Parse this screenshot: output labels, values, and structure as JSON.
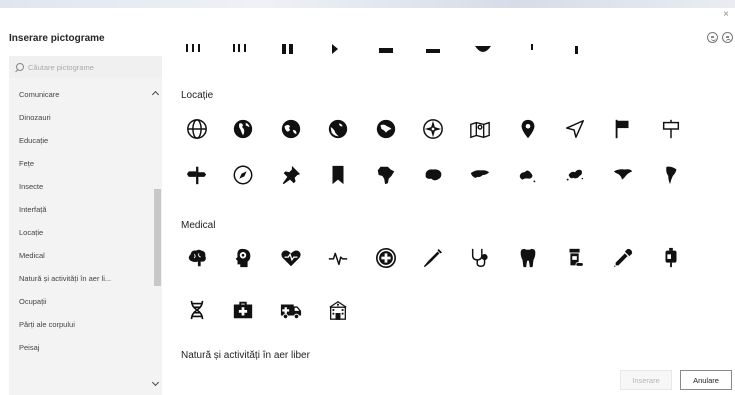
{
  "dialog": {
    "title": "Inserare pictograme",
    "close_label": "×"
  },
  "search": {
    "placeholder": "Căutare pictograme"
  },
  "sidebar": {
    "items": [
      {
        "label": "Comunicare"
      },
      {
        "label": "Dinozauri"
      },
      {
        "label": "Educație"
      },
      {
        "label": "Fețe"
      },
      {
        "label": "Insecte"
      },
      {
        "label": "Interfață"
      },
      {
        "label": "Locație"
      },
      {
        "label": "Medical"
      },
      {
        "label": "Natură și activități în aer li..."
      },
      {
        "label": "Ocupații"
      },
      {
        "label": "Părți ale corpului"
      },
      {
        "label": "Peisaj"
      }
    ]
  },
  "sections": {
    "locatie": {
      "title": "Locație",
      "icons": [
        "globe-icon",
        "globe-americas-icon",
        "globe-west-icon",
        "globe-europe-icon",
        "globe-asia-icon",
        "compass-rose-icon",
        "folded-map-icon",
        "map-pin-icon",
        "navigation-arrow-icon",
        "flag-icon",
        "signpost-icon",
        "direction-sign-icon",
        "compass-icon",
        "pushpin-icon",
        "bookmark-icon",
        "africa-icon",
        "antarctica-icon",
        "asia-icon",
        "australia-icon",
        "europe-icon",
        "north-america-icon",
        "south-america-icon"
      ]
    },
    "medical": {
      "title": "Medical",
      "icons": [
        "brain-icon",
        "head-brain-icon",
        "heart-pulse-icon",
        "heartbeat-line-icon",
        "medical-cross-icon",
        "syringe-icon",
        "stethoscope-icon",
        "tooth-icon",
        "pill-bottle-icon",
        "dropper-icon",
        "iv-bag-icon",
        "dna-icon",
        "first-aid-kit-icon",
        "ambulance-icon",
        "hospital-icon"
      ]
    },
    "natura": {
      "title": "Natură și activități în aer liber"
    }
  },
  "footer": {
    "insert_label": "Inserare",
    "cancel_label": "Anulare"
  }
}
